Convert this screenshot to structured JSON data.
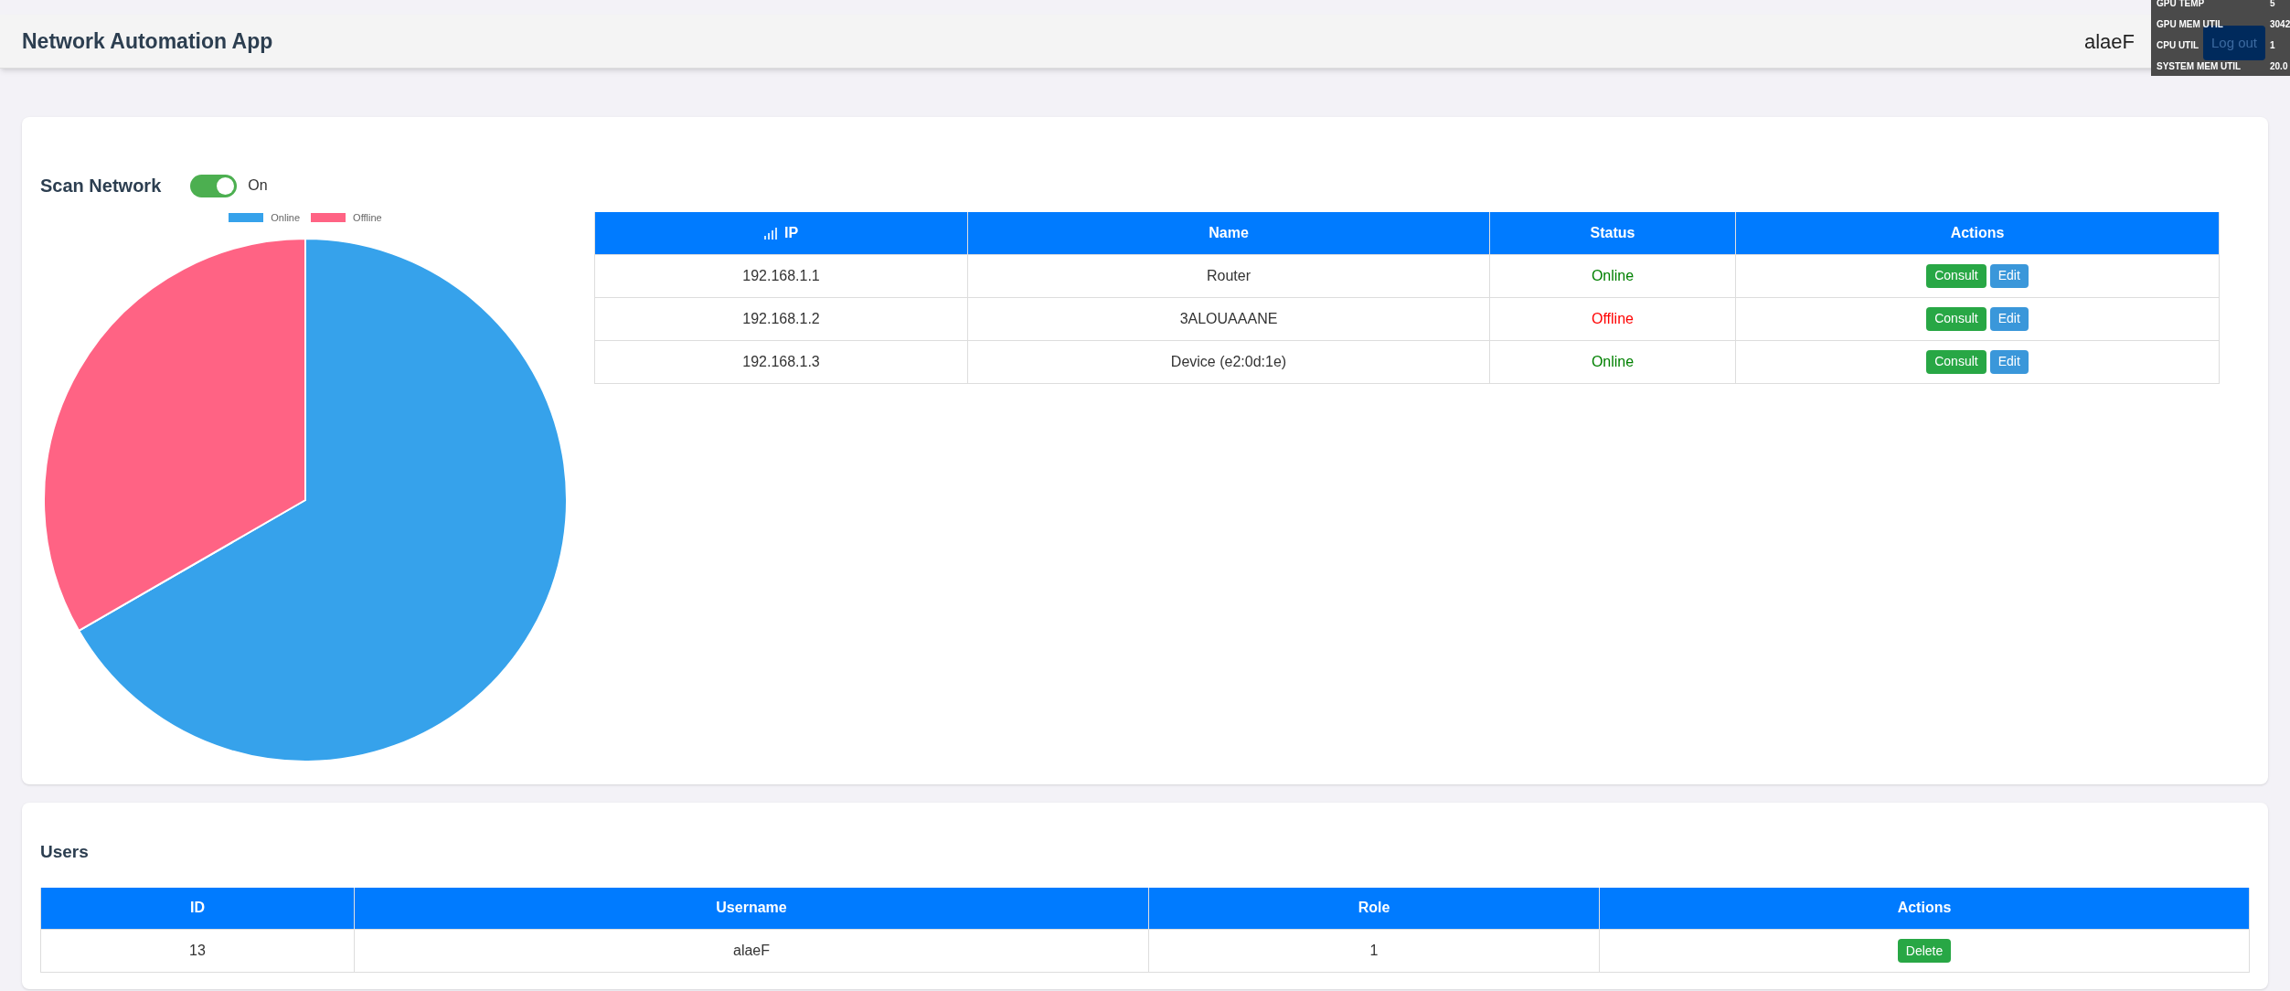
{
  "header": {
    "title": "Network Automation App",
    "username": "alaeF",
    "logout": "Log out"
  },
  "monitor": [
    {
      "label": "GPU TEMP",
      "value": "5"
    },
    {
      "label": "GPU MEM UTIL",
      "value": "3042"
    },
    {
      "label": "CPU UTIL",
      "value": "1"
    },
    {
      "label": "SYSTEM MEM UTIL",
      "value": "20.0"
    }
  ],
  "scan": {
    "title": "Scan Network",
    "toggle": {
      "on": true,
      "label": "On"
    },
    "chart_data": {
      "type": "pie",
      "categories": [
        "Online",
        "Offline"
      ],
      "values": [
        66.67,
        33.33
      ],
      "colors": [
        "#36a2eb",
        "#ff6384"
      ],
      "legend": "top"
    }
  },
  "devices": {
    "columns": [
      "IP",
      "Name",
      "Status",
      "Actions"
    ],
    "rows": [
      {
        "ip": "192.168.1.1",
        "name": "Router",
        "status": "Online",
        "online": true,
        "actions": [
          "Consult",
          "Edit"
        ]
      },
      {
        "ip": "192.168.1.2",
        "name": "3ALOUAAANE",
        "status": "Offline",
        "online": false,
        "actions": [
          "Consult",
          "Edit"
        ]
      },
      {
        "ip": "192.168.1.3",
        "name": "Device (e2:0d:1e)",
        "status": "Online",
        "online": true,
        "actions": [
          "Consult",
          "Edit"
        ]
      }
    ]
  },
  "users": {
    "title": "Users",
    "columns": [
      "ID",
      "Username",
      "Role",
      "Actions"
    ],
    "rows": [
      {
        "id": "13",
        "username": "alaeF",
        "role": "1",
        "action": "Delete"
      }
    ]
  }
}
